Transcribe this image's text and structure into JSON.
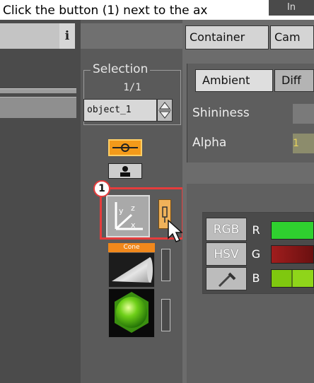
{
  "caption": {
    "text": "Click the button (1) next to the ax",
    "tab_label": "In"
  },
  "left_panel": {
    "info_button": "i"
  },
  "selection": {
    "legend": "Selection",
    "count": "1/1",
    "object_name": "object_1"
  },
  "objects": {
    "cone_label": "Cone",
    "callout_number": "1"
  },
  "tabs": [
    "Container",
    "Cam"
  ],
  "material": {
    "subtabs": [
      "Ambient",
      "Diff"
    ],
    "properties": [
      "Shininess",
      "Alpha"
    ],
    "alpha_value_glimpse": "1"
  },
  "color_panel": {
    "modes": [
      "RGB",
      "HSV"
    ],
    "channels": [
      "R",
      "G",
      "B"
    ]
  },
  "colors": {
    "highlight": "#e53c3c",
    "red_channel": "#2fd02f",
    "green_channel": "#8a1b1b",
    "blue_channel": "#8ccf12",
    "orange": "#f39a1a"
  },
  "icons": [
    "info-icon",
    "spin-up-icon",
    "spin-down-icon",
    "camera-link-icon",
    "person-icon",
    "axis-icon",
    "pin-icon",
    "cone-thumbnail",
    "sphere-thumbnail",
    "eyedropper-icon",
    "cursor-icon"
  ]
}
